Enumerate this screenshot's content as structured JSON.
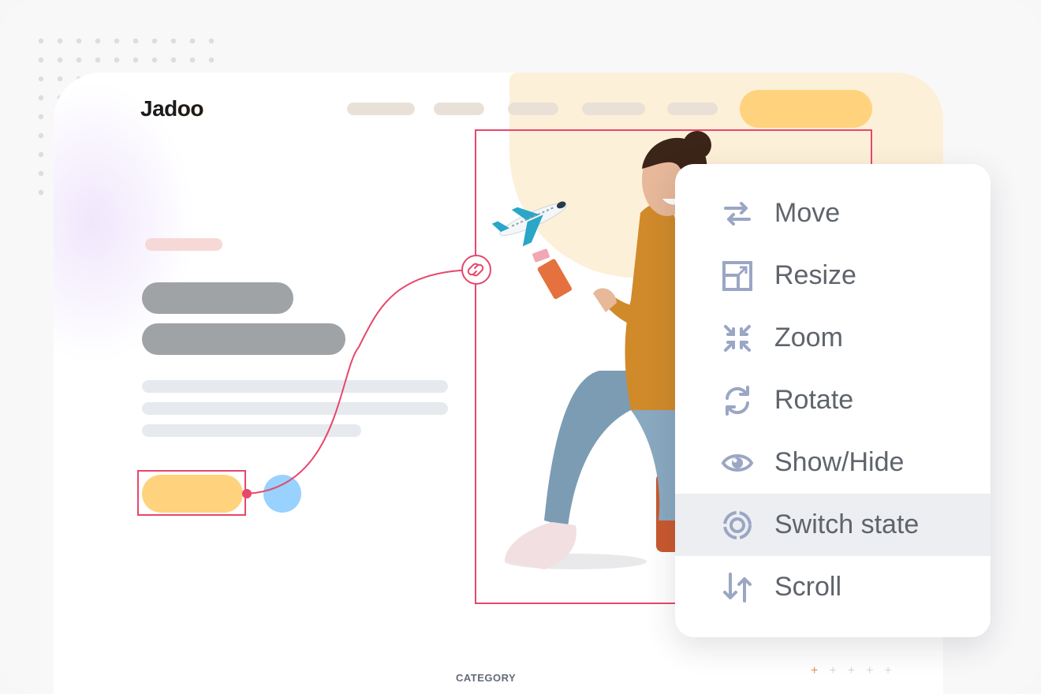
{
  "site": {
    "logo": "Jadoo",
    "category_label": "CATEGORY"
  },
  "context_menu": {
    "items": [
      {
        "label": "Move",
        "icon": "move-arrows-icon",
        "active": false
      },
      {
        "label": "Resize",
        "icon": "resize-icon",
        "active": false
      },
      {
        "label": "Zoom",
        "icon": "zoom-icon",
        "active": false
      },
      {
        "label": "Rotate",
        "icon": "rotate-icon",
        "active": false
      },
      {
        "label": "Show/Hide",
        "icon": "eye-icon",
        "active": false
      },
      {
        "label": "Switch state",
        "icon": "switch-state-icon",
        "active": true
      },
      {
        "label": "Scroll",
        "icon": "scroll-arrows-icon",
        "active": false
      }
    ]
  },
  "colors": {
    "accent_red": "#e7476b",
    "cta_yellow": "#ffd27d",
    "icon_blue_gray": "#9aa6c4",
    "highlight_gray": "#eceef1"
  }
}
